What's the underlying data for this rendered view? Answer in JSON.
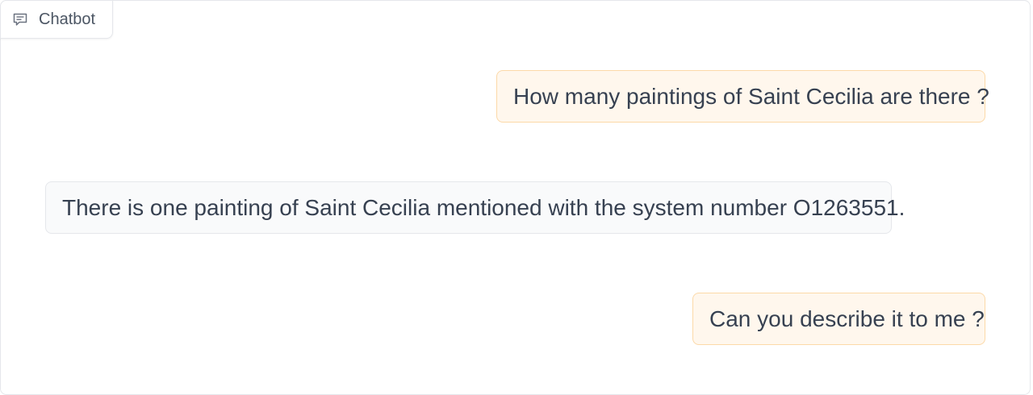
{
  "chatbot": {
    "label": "Chatbot",
    "label_icon": "chat-bubble-icon"
  },
  "messages": [
    {
      "role": "user",
      "text": "How many paintings of Saint Cecilia are there ?"
    },
    {
      "role": "bot",
      "text": "There is one painting of Saint Cecilia mentioned with the system number O1263551."
    },
    {
      "role": "user",
      "text": "Can you describe it to me ?"
    }
  ],
  "colors": {
    "user_bubble_bg": "#fff7ed",
    "user_bubble_border": "#fcd9a8",
    "bot_bubble_bg": "#f9fafb",
    "bot_bubble_border": "#e5e7eb"
  }
}
